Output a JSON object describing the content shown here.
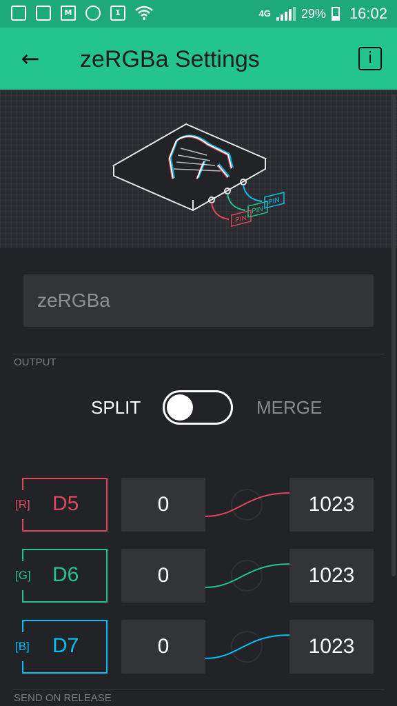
{
  "status_bar": {
    "network": "4G",
    "battery": "29%",
    "time": "16:02"
  },
  "header": {
    "title": "zeRGBa Settings"
  },
  "hero": {
    "pin_labels": [
      "PIN",
      "PIN",
      "PIN"
    ]
  },
  "name_field": {
    "value": "zeRGBa"
  },
  "output": {
    "section_label": "OUTPUT",
    "split_label": "SPLIT",
    "merge_label": "MERGE",
    "mode": "split"
  },
  "pins": [
    {
      "channel": "[R]",
      "pin": "D5",
      "min": "0",
      "max": "1023",
      "color": "#e2465e"
    },
    {
      "channel": "[G]",
      "pin": "D6",
      "min": "0",
      "max": "1023",
      "color": "#23c48e"
    },
    {
      "channel": "[B]",
      "pin": "D7",
      "min": "0",
      "max": "1023",
      "color": "#04c0f8"
    }
  ],
  "send_on_release": {
    "section_label": "SEND ON RELEASE"
  },
  "icons": [
    "screenshot-icon",
    "gallery-icon",
    "gmail-icon",
    "headset-icon",
    "calendar-icon",
    "wifi-icon",
    "signal-icon",
    "battery-icon",
    "back-arrow-icon",
    "info-icon"
  ]
}
